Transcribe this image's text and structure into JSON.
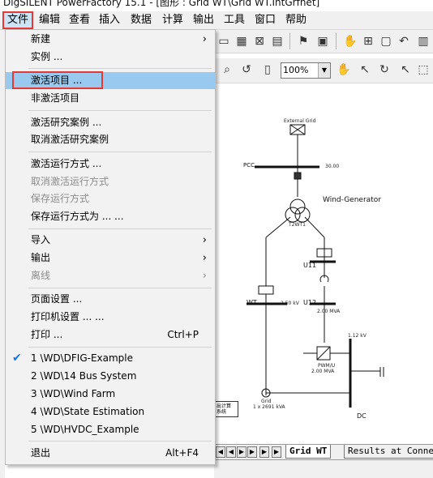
{
  "window": {
    "title": "DigSILENT PowerFactory 15.1 - [图形 : Grid WT\\Grid WT.IntGrfnet]"
  },
  "menubar": {
    "items": [
      "文件",
      "编辑",
      "查看",
      "插入",
      "数据",
      "计算",
      "输出",
      "工具",
      "窗口",
      "帮助"
    ]
  },
  "toolbar": {
    "zoom_value": "100%"
  },
  "file_menu": {
    "new": "新建",
    "examples": "实例 ...",
    "activate_project": "激活项目 ...",
    "deactivate_project": "非激活项目",
    "activate_case": "激活研究案例 ...",
    "deactivate_case": "取消激活研究案例",
    "activate_scenario": "激活运行方式 ...",
    "deactivate_scenario": "取消激活运行方式",
    "save_scenario": "保存运行方式",
    "save_scenario_as": "保存运行方式为 ... ...",
    "import": "导入",
    "export": "输出",
    "offline": "离线",
    "page_setup": "页面设置 ...",
    "printer_setup": "打印机设置 ... ...",
    "print": "打印 ...",
    "print_shortcut": "Ctrl+P",
    "recent": [
      "1 \\WD\\DFIG-Example",
      "2 \\WD\\14 Bus System",
      "3 \\WD\\Wind Farm",
      "4 \\WD\\State Estimation",
      "5 \\WD\\HVDC_Example"
    ],
    "exit": "退出",
    "exit_shortcut": "Alt+F4"
  },
  "diagram": {
    "external_grid": "External Grid",
    "pcc": "PCC",
    "pcc_val": "30.00",
    "wind_generator": "Wind-Generator",
    "t2wt": "T2WT1",
    "u11": "U11",
    "u12": "U12",
    "wt": "WT",
    "wt_val": "2.50 kV",
    "u12_val": "2.00 MVA",
    "kv": "1.12 kV",
    "mva_side": "2.00 MVA",
    "pwm": "PWM/U",
    "grid": "Grid",
    "grid_val": "1 x 2691 kVA",
    "dc": "DC",
    "box_text": "出计算\n系统"
  },
  "tabs": [
    "Grid WT",
    "Results at Connec"
  ]
}
